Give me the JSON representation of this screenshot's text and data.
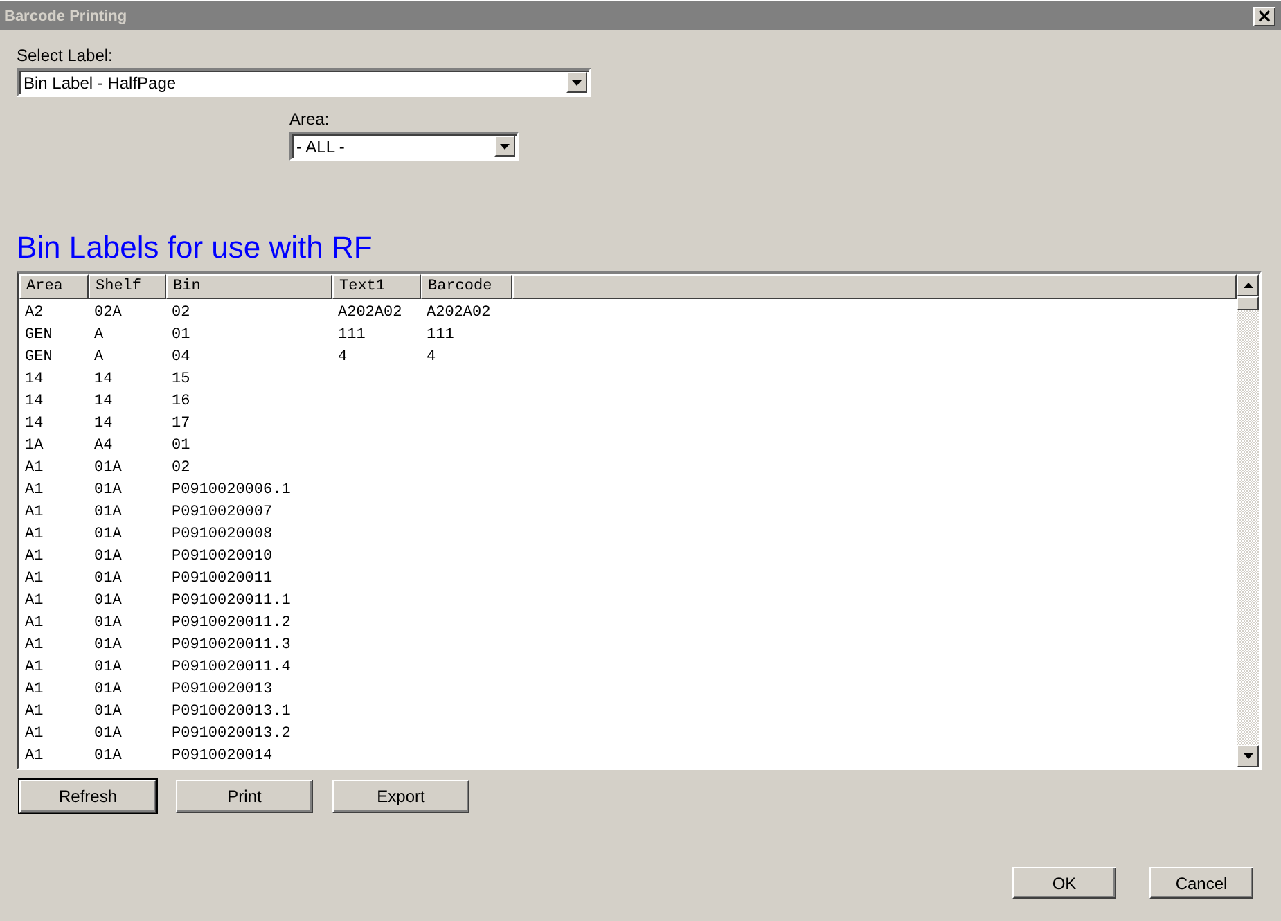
{
  "window": {
    "title": "Barcode Printing",
    "close": "×"
  },
  "label_select": {
    "label": "Select Label:",
    "value": "Bin Label - HalfPage"
  },
  "area_select": {
    "label": "Area:",
    "value": "- ALL -"
  },
  "heading": "Bin Labels for use with RF",
  "table": {
    "columns": [
      "Area",
      "Shelf",
      "Bin",
      "Text1",
      "Barcode"
    ],
    "rows": [
      [
        "A2",
        "02A",
        "02",
        "A202A02",
        "A202A02"
      ],
      [
        "GEN",
        "A",
        "01",
        "111",
        "111"
      ],
      [
        "GEN",
        "A",
        "04",
        "4",
        "4"
      ],
      [
        "14",
        "14",
        "15",
        "",
        ""
      ],
      [
        "14",
        "14",
        "16",
        "",
        ""
      ],
      [
        "14",
        "14",
        "17",
        "",
        ""
      ],
      [
        "1A",
        "A4",
        "01",
        "",
        ""
      ],
      [
        "A1",
        "01A",
        "02",
        "",
        ""
      ],
      [
        "A1",
        "01A",
        "P0910020006.1",
        "",
        ""
      ],
      [
        "A1",
        "01A",
        "P0910020007",
        "",
        ""
      ],
      [
        "A1",
        "01A",
        "P0910020008",
        "",
        ""
      ],
      [
        "A1",
        "01A",
        "P0910020010",
        "",
        ""
      ],
      [
        "A1",
        "01A",
        "P0910020011",
        "",
        ""
      ],
      [
        "A1",
        "01A",
        "P0910020011.1",
        "",
        ""
      ],
      [
        "A1",
        "01A",
        "P0910020011.2",
        "",
        ""
      ],
      [
        "A1",
        "01A",
        "P0910020011.3",
        "",
        ""
      ],
      [
        "A1",
        "01A",
        "P0910020011.4",
        "",
        ""
      ],
      [
        "A1",
        "01A",
        "P0910020013",
        "",
        ""
      ],
      [
        "A1",
        "01A",
        "P0910020013.1",
        "",
        ""
      ],
      [
        "A1",
        "01A",
        "P0910020013.2",
        "",
        ""
      ],
      [
        "A1",
        "01A",
        "P0910020014",
        "",
        ""
      ]
    ]
  },
  "actions": [
    {
      "label": "Refresh",
      "default": true
    },
    {
      "label": "Print",
      "default": false
    },
    {
      "label": "Export",
      "default": false
    }
  ],
  "buttons": [
    "OK",
    "Cancel"
  ]
}
